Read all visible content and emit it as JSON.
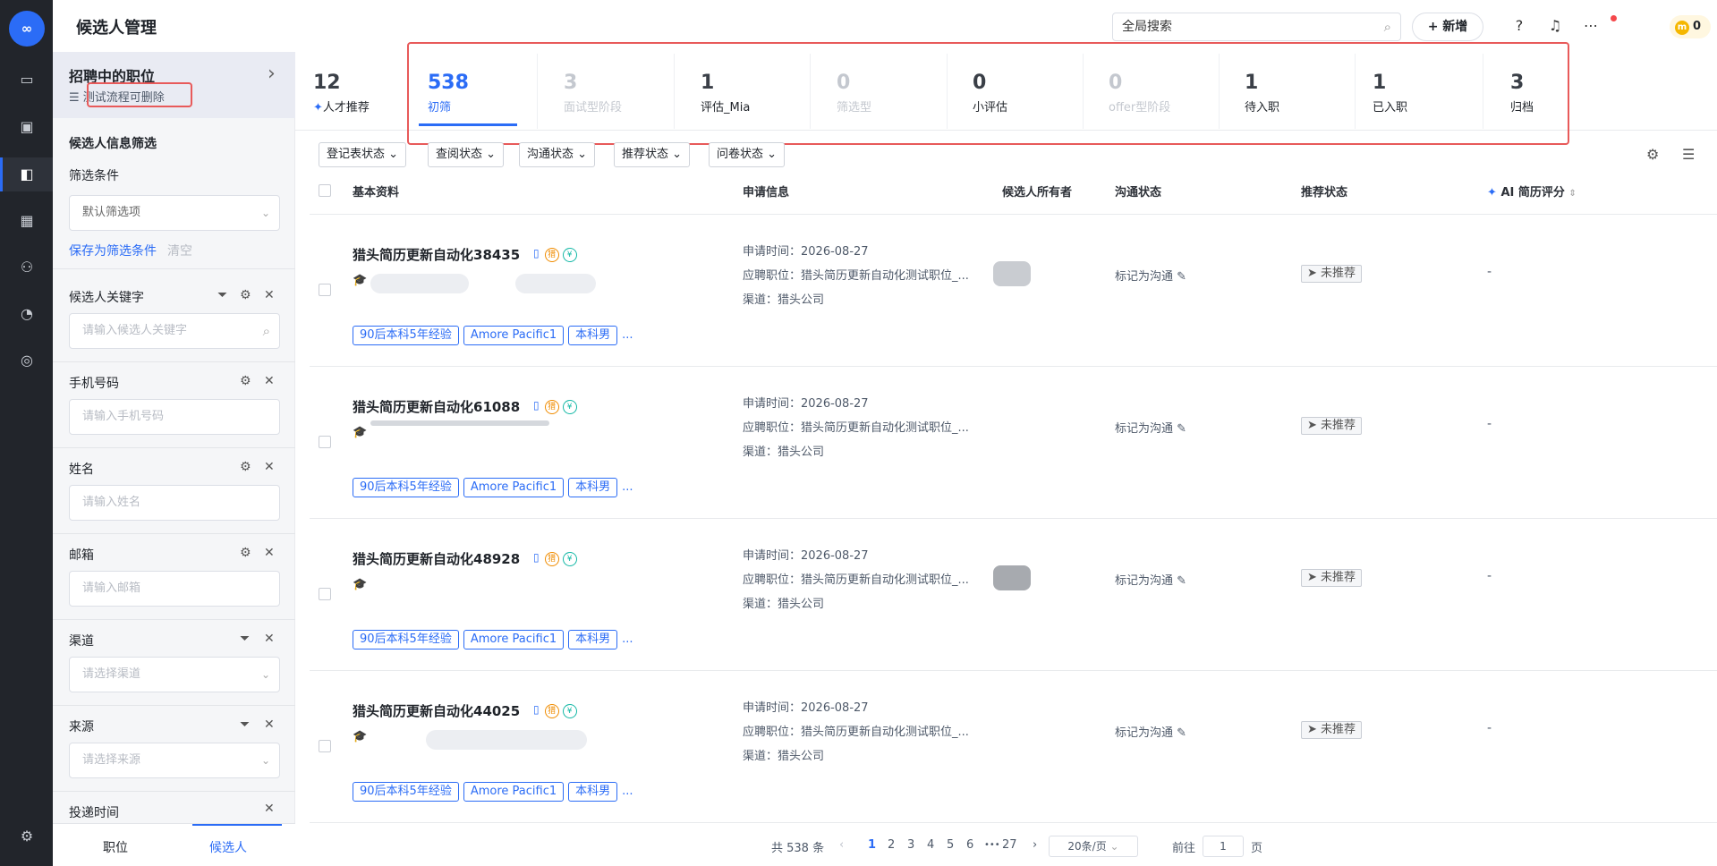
{
  "app": {
    "logo_text": "∞",
    "title": "候选人管理"
  },
  "header": {
    "search_placeholder": "全局搜索",
    "new_label": "+ 新增",
    "coin_count": "0"
  },
  "sidebar": {
    "job_card": {
      "title": "招聘中的职位",
      "subtitle": "测试流程可删除"
    },
    "section_title": "候选人信息筛选",
    "filter_label": "筛选条件",
    "filter_select": "默认筛选项",
    "save_filter": "保存为筛选条件",
    "clear": "清空",
    "fields": [
      {
        "label": "候选人关键字",
        "placeholder": "请输入候选人关键字"
      },
      {
        "label": "手机号码",
        "placeholder": "请输入手机号码"
      },
      {
        "label": "姓名",
        "placeholder": "请输入姓名"
      },
      {
        "label": "邮箱",
        "placeholder": "请输入邮箱"
      },
      {
        "label": "渠道",
        "placeholder": "请选择渠道"
      },
      {
        "label": "来源",
        "placeholder": "请选择来源"
      },
      {
        "label": "投递时间",
        "placeholder": ""
      }
    ],
    "bottom_tabs": [
      "职位",
      "候选人"
    ]
  },
  "stages": [
    {
      "count": "12",
      "label": "人才推荐",
      "state": "normal"
    },
    {
      "count": "538",
      "label": "初筛",
      "state": "active"
    },
    {
      "count": "3",
      "label": "面试型阶段",
      "state": "disabled"
    },
    {
      "count": "1",
      "label": "评估_Mia",
      "state": "normal"
    },
    {
      "count": "0",
      "label": "筛选型",
      "state": "disabled"
    },
    {
      "count": "0",
      "label": "小评估",
      "state": "normal"
    },
    {
      "count": "0",
      "label": "offer型阶段",
      "state": "disabled"
    },
    {
      "count": "1",
      "label": "待入职",
      "state": "normal"
    },
    {
      "count": "1",
      "label": "已入职",
      "state": "normal"
    },
    {
      "count": "3",
      "label": "归档",
      "state": "normal"
    }
  ],
  "filters": [
    "登记表状态",
    "查阅状态",
    "沟通状态",
    "推荐状态",
    "问卷状态"
  ],
  "table": {
    "headers": [
      "基本资料",
      "申请信息",
      "候选人所有者",
      "沟通状态",
      "推荐状态",
      "AI 简历评分"
    ],
    "rows": [
      {
        "name": "猎头简历更新自动化38435",
        "apply_time": "申请时间：2026-08-27",
        "position": "应聘职位：猎头简历更新自动化测试职位_...",
        "channel": "渠道：猎头公司",
        "comm": "标记为沟通",
        "rec": "未推荐",
        "ai": "-",
        "tags": [
          "90后本科5年经验",
          "Amore Pacific1",
          "本科男"
        ],
        "more": "..."
      },
      {
        "name": "猎头简历更新自动化61088",
        "apply_time": "申请时间：2026-08-27",
        "position": "应聘职位：猎头简历更新自动化测试职位_...",
        "channel": "渠道：猎头公司",
        "comm": "标记为沟通",
        "rec": "未推荐",
        "ai": "-",
        "tags": [
          "90后本科5年经验",
          "Amore Pacific1",
          "本科男"
        ],
        "more": "..."
      },
      {
        "name": "猎头简历更新自动化48928",
        "apply_time": "申请时间：2026-08-27",
        "position": "应聘职位：猎头简历更新自动化测试职位_...",
        "channel": "渠道：猎头公司",
        "comm": "标记为沟通",
        "rec": "未推荐",
        "ai": "-",
        "tags": [
          "90后本科5年经验",
          "Amore Pacific1",
          "本科男"
        ],
        "more": "..."
      },
      {
        "name": "猎头简历更新自动化44025",
        "apply_time": "申请时间：2026-08-27",
        "position": "应聘职位：猎头简历更新自动化测试职位_...",
        "channel": "渠道：猎头公司",
        "comm": "标记为沟通",
        "rec": "未推荐",
        "ai": "-",
        "tags": [
          "90后本科5年经验",
          "Amore Pacific1",
          "本科男"
        ],
        "more": "..."
      }
    ]
  },
  "pager": {
    "total": "共 538 条",
    "pages": [
      "1",
      "2",
      "3",
      "4",
      "5",
      "6",
      "•••",
      "27"
    ],
    "size": "20条/页",
    "goto": "前往",
    "goto_value": "1",
    "page_unit": "页"
  }
}
